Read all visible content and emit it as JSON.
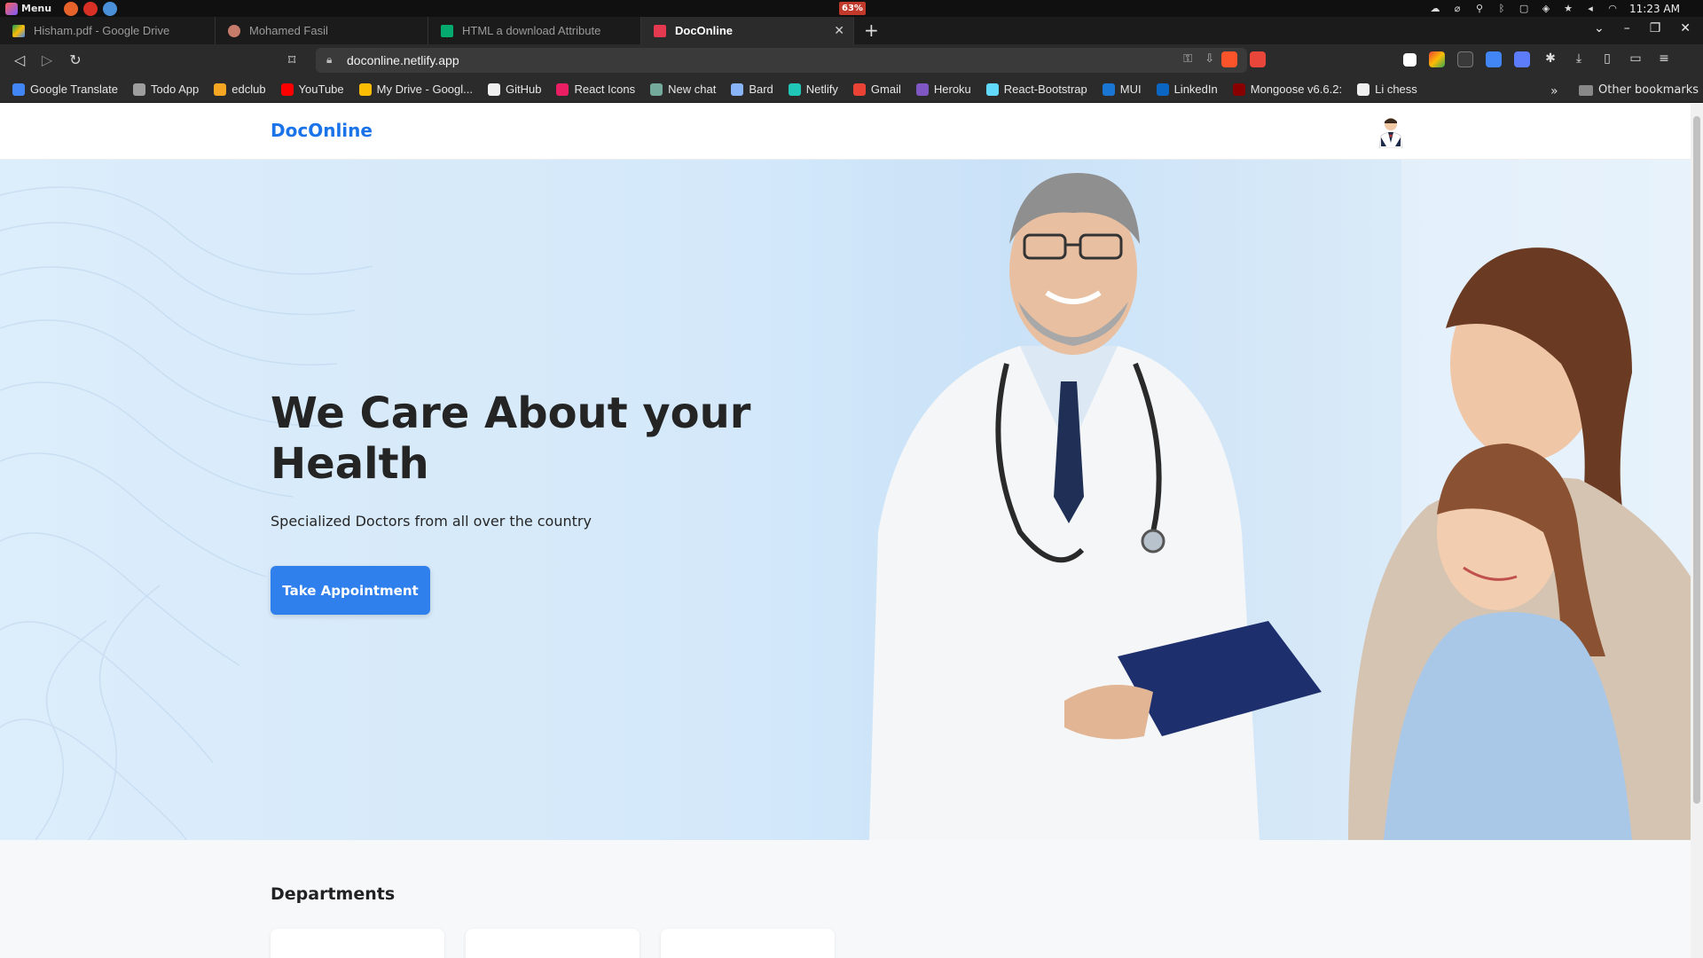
{
  "os": {
    "menu_label": "Menu",
    "battery": "63%",
    "clock": "11:23 AM"
  },
  "tabs": [
    {
      "title": "Hisham.pdf - Google Drive",
      "icon": "google-drive-icon",
      "active": false
    },
    {
      "title": "Mohamed Fasil",
      "icon": "profile-icon",
      "active": false
    },
    {
      "title": "HTML a download Attribute",
      "icon": "w3schools-icon",
      "active": false
    },
    {
      "title": "DocOnline",
      "icon": "doconline-icon",
      "active": true
    }
  ],
  "toolbar": {
    "url": "doconline.netlify.app"
  },
  "bookmarks": [
    {
      "label": "Google Translate",
      "icon": "google-translate-icon",
      "color": "#4285f4"
    },
    {
      "label": "Todo App",
      "icon": "globe-icon",
      "color": "#9e9e9e"
    },
    {
      "label": "edclub",
      "icon": "edclub-icon",
      "color": "#f5a623"
    },
    {
      "label": "YouTube",
      "icon": "youtube-icon",
      "color": "#ff0000"
    },
    {
      "label": "My Drive - Googl...",
      "icon": "google-drive-icon",
      "color": "#fbbc04"
    },
    {
      "label": "GitHub",
      "icon": "github-icon",
      "color": "#f0f0f0"
    },
    {
      "label": "React Icons",
      "icon": "react-icon",
      "color": "#e91e63"
    },
    {
      "label": "New chat",
      "icon": "chatgpt-icon",
      "color": "#74aa9c"
    },
    {
      "label": "Bard",
      "icon": "bard-icon",
      "color": "#8ab4f8"
    },
    {
      "label": "Netlify",
      "icon": "netlify-icon",
      "color": "#20c6b7"
    },
    {
      "label": "Gmail",
      "icon": "gmail-icon",
      "color": "#ea4335"
    },
    {
      "label": "Heroku",
      "icon": "heroku-icon",
      "color": "#7e57c2"
    },
    {
      "label": "React-Bootstrap",
      "icon": "react-icon",
      "color": "#61dafb"
    },
    {
      "label": "MUI",
      "icon": "mui-icon",
      "color": "#1976d2"
    },
    {
      "label": "LinkedIn",
      "icon": "linkedin-icon",
      "color": "#0a66c2"
    },
    {
      "label": "Mongoose v6.6.2:",
      "icon": "mongoose-icon",
      "color": "#880000"
    },
    {
      "label": "Li chess",
      "icon": "lichess-icon",
      "color": "#f0f0f0"
    }
  ],
  "bookmarks_more": "»",
  "other_bookmarks": "Other bookmarks",
  "site": {
    "brand": "DocOnline",
    "brand_color": "#1a73e8",
    "hero_title": "We Care About your Health",
    "hero_subtitle": "Specialized Doctors from all over the country",
    "cta_label": "Take Appointment",
    "cta_color": "#2f80ed",
    "departments_title": "Departments"
  }
}
